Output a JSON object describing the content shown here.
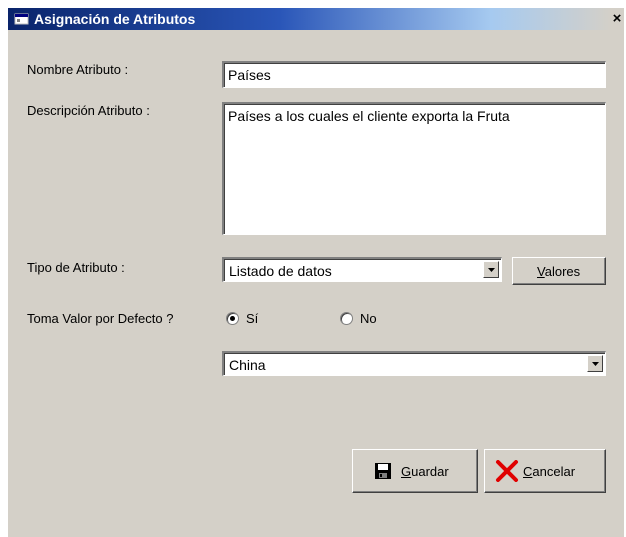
{
  "window": {
    "title": "Asignación de Atributos",
    "close_glyph": "×"
  },
  "form": {
    "nombre_label": "Nombre Atributo :",
    "nombre_value": "Países",
    "descripcion_label": "Descripción Atributo :",
    "descripcion_value": "Países a los cuales el cliente exporta la Fruta",
    "tipo_label": "Tipo de Atributo :",
    "tipo_value": "Listado de datos",
    "valores_button": {
      "accel": "V",
      "rest": "alores"
    },
    "default_label": "Toma Valor por Defecto ?",
    "radio_si": "Sí",
    "radio_no": "No",
    "radio_selected": "Sí",
    "default_value": "China"
  },
  "buttons": {
    "guardar": {
      "accel": "G",
      "rest": "uardar"
    },
    "cancelar": {
      "accel": "C",
      "rest": "ancelar"
    }
  },
  "icons": {
    "title": "window-app-icon",
    "save": "floppy-disk-icon",
    "cancel": "red-x-icon",
    "dropdown": "chevron-down-icon"
  }
}
